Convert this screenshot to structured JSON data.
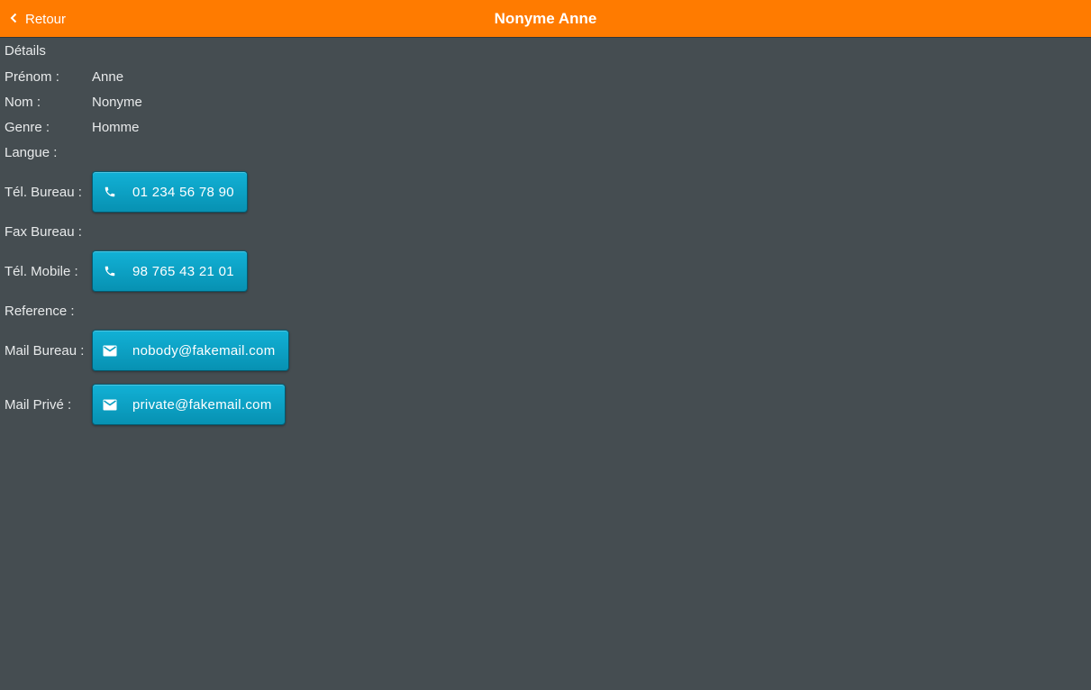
{
  "header": {
    "back_label": "Retour",
    "title": "Nonyme Anne",
    "color": "#ff7b00"
  },
  "details": {
    "section_title": "Détails",
    "first_name": {
      "label": "Prénom :",
      "value": "Anne"
    },
    "last_name": {
      "label": "Nom :",
      "value": "Nonyme"
    },
    "gender": {
      "label": "Genre :",
      "value": "Homme"
    },
    "language": {
      "label": "Langue :",
      "value": ""
    },
    "office_phone": {
      "label": "Tél. Bureau :",
      "value": "01 234 56 78 90",
      "icon": "phone-icon"
    },
    "office_fax": {
      "label": "Fax Bureau :",
      "value": ""
    },
    "mobile_phone": {
      "label": "Tél. Mobile :",
      "value": "98 765 43 21 01",
      "icon": "phone-icon"
    },
    "reference": {
      "label": "Reference :",
      "value": ""
    },
    "office_mail": {
      "label": "Mail Bureau :",
      "value": "nobody@fakemail.com",
      "icon": "mail-icon"
    },
    "private_mail": {
      "label": "Mail Privé :",
      "value": "private@fakemail.com",
      "icon": "mail-icon"
    }
  },
  "colors": {
    "background": "#454d51",
    "button": "#0aa0c4"
  }
}
